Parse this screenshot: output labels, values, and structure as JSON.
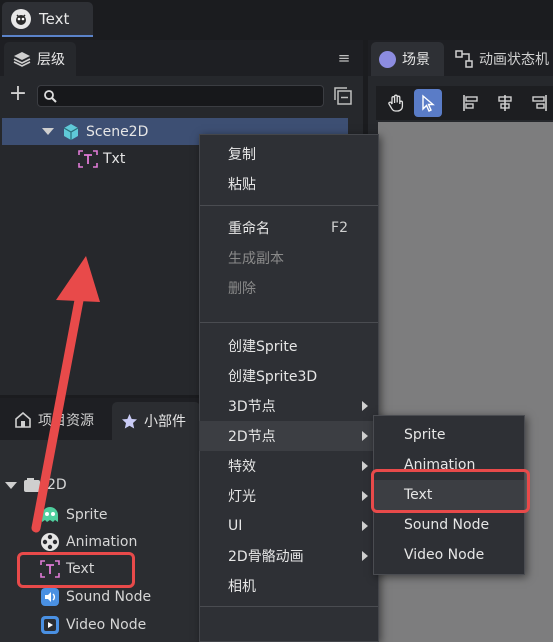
{
  "doc_tab": {
    "title": "Text"
  },
  "hierarchy": {
    "tab_label": "层级",
    "search_value": "",
    "tree": [
      {
        "label": "Scene2D",
        "selected": true
      },
      {
        "label": "Txt",
        "selected": false
      }
    ]
  },
  "scene": {
    "tab_label": "场景",
    "anim_tab_label": "动画状态机"
  },
  "resources": {
    "tab_assets": "项目资源",
    "tab_widgets": "小部件",
    "group_label": "2D",
    "items": [
      {
        "label": "Sprite",
        "icon": "sprite-icon"
      },
      {
        "label": "Animation",
        "icon": "animation-icon"
      },
      {
        "label": "Text",
        "icon": "text-icon"
      },
      {
        "label": "Sound Node",
        "icon": "sound-icon"
      },
      {
        "label": "Video Node",
        "icon": "video-icon"
      }
    ]
  },
  "context_menu": {
    "copy": "复制",
    "paste": "粘贴",
    "rename": "重命名",
    "rename_shortcut": "F2",
    "duplicate": "生成副本",
    "delete": "删除",
    "create_sprite": "创建Sprite",
    "create_sprite3d": "创建Sprite3D",
    "node3d": "3D节点",
    "node2d": "2D节点",
    "effects": "特效",
    "light": "灯光",
    "ui": "UI",
    "skeleton2d": "2D骨骼动画",
    "camera": "相机"
  },
  "submenu_2d": {
    "items": [
      "Sprite",
      "Animation",
      "Text",
      "Sound Node",
      "Video Node"
    ],
    "highlighted": "Text"
  },
  "colors": {
    "annotation_red": "#e84a4a",
    "selection_blue": "#3d4f73",
    "text_icon_pink": "#e07bd6"
  }
}
